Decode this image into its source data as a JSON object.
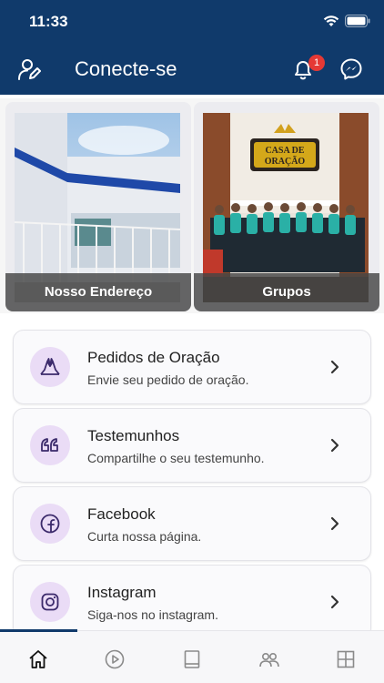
{
  "status_bar": {
    "time": "11:33"
  },
  "header": {
    "title": "Conecte-se",
    "notification_count": "1",
    "background": "#103a6b"
  },
  "tiles": [
    {
      "label": "Nosso Endereço",
      "image": "church-building-photo"
    },
    {
      "label": "Grupos",
      "image": "choir-group-photo",
      "sign_text": "CASA DE ORAÇÃO"
    }
  ],
  "list": [
    {
      "title": "Pedidos de Oração",
      "subtitle": "Envie seu pedido de oração.",
      "icon": "praying-hands-icon"
    },
    {
      "title": "Testemunhos",
      "subtitle": "Compartilhe o seu testemunho.",
      "icon": "quote-icon"
    },
    {
      "title": "Facebook",
      "subtitle": "Curta nossa página.",
      "icon": "facebook-icon"
    },
    {
      "title": "Instagram",
      "subtitle": "Siga-nos no instagram.",
      "icon": "instagram-icon"
    }
  ],
  "tabbar": {
    "items": [
      "home-icon",
      "play-icon",
      "book-icon",
      "people-icon",
      "grid-icon"
    ],
    "active": "home-icon"
  },
  "colors": {
    "accent": "#103a6b",
    "icon_bg": "#eadcf6",
    "icon_fg": "#3b2a6b",
    "badge": "#e53935"
  }
}
